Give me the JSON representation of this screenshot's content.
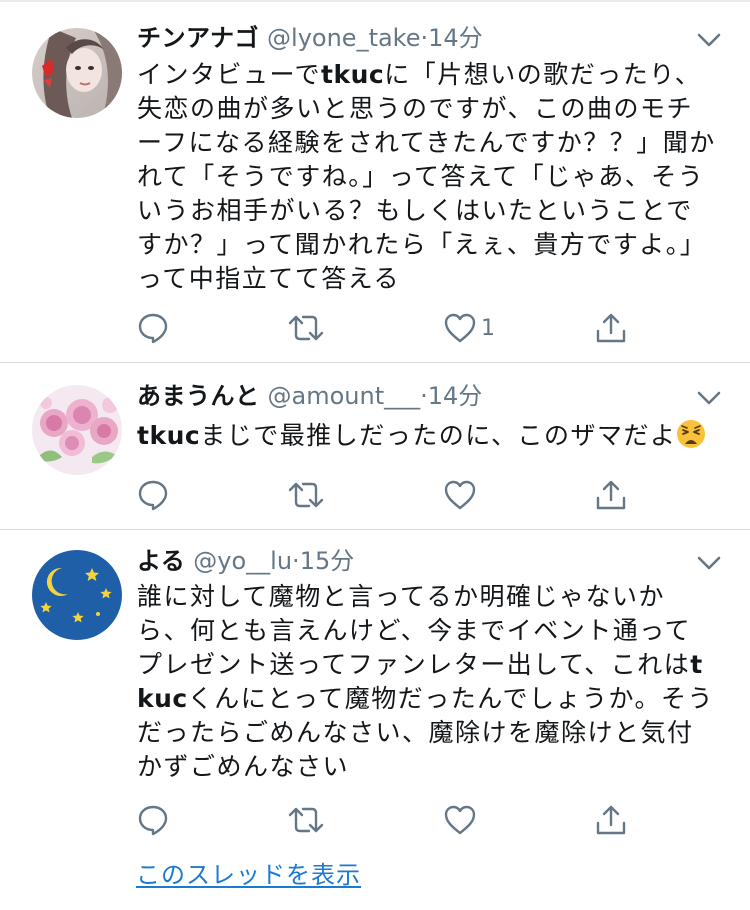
{
  "tweets": [
    {
      "name": "チンアナゴ",
      "handle": "@lyone_take",
      "separator": "·",
      "time": "14分",
      "body_pre": "インタビューで",
      "body_bold": "tkuc",
      "body_post": "に「片想いの歌だったり、失恋の曲が多いと思うのですが、この曲のモチーフになる経験をされてきたんですか？？」聞かれて「そうですね。」って答えて「じゃあ、そういうお相手がいる？もしくはいたということですか？」って聞かれたら「えぇ、貴方ですよ。」って中指立てて答える",
      "like_count": "1",
      "avatar": "woman-photo"
    },
    {
      "name": "あまうんと",
      "handle": "@amount___",
      "separator": "·",
      "time": "14分",
      "body_pre": "",
      "body_bold": "tkuc",
      "body_post": "まじで最推しだったのに、このザマだよ",
      "emoji": "weary-face",
      "like_count": "",
      "avatar": "roses-photo"
    },
    {
      "name": "よる",
      "handle": "@yo__lu",
      "separator": "·",
      "time": "15分",
      "body_pre": "誰に対して魔物と言ってるか明確じゃないから、何とも言えんけど、今までイベント通ってプレゼント送ってファンレター出して、これは",
      "body_bold": "tkuc",
      "body_post": "くんにとって魔物だったんでしょうか。そうだったらごめんなさい、魔除けを魔除けと気付かずごめんなさい",
      "like_count": "",
      "avatar": "moon-stars"
    }
  ],
  "thread_link": "このスレッドを表示",
  "icons": {
    "reply": "reply-icon",
    "retweet": "retweet-icon",
    "like": "like-icon",
    "share": "share-icon",
    "menu": "chevron-down-icon"
  },
  "colors": {
    "text": "#14171a",
    "secondary": "#657786",
    "link": "#1b7ad1",
    "icon": "#657786",
    "divider": "#d7dde2"
  }
}
